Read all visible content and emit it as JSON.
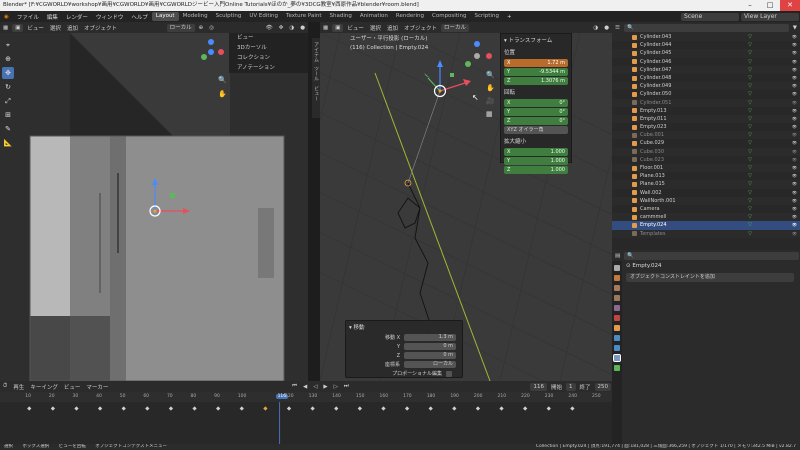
{
  "titlebar": {
    "title": "Blender* [F:¥CGWORLD¥workshop¥画用¥CGWORLD¥画用¥CGWORLDジービー入門Online Tutorials¥ほのか_夢の¥3DCG教室¥西原作品¥blender¥room.blend]"
  },
  "menubar": {
    "items": [
      "ファイル",
      "編集",
      "レンダー",
      "ウィンドウ",
      "ヘルプ"
    ],
    "workspaces": [
      "Layout",
      "Modeling",
      "Sculpting",
      "UV Editing",
      "Texture Paint",
      "Shading",
      "Animation",
      "Rendering",
      "Compositing",
      "Scripting"
    ],
    "active_workspace": "Layout",
    "scene": "Scene",
    "view_layer": "View Layer"
  },
  "viewport_left": {
    "header": [
      "ビュー",
      "選択",
      "追加",
      "オブジェクト"
    ],
    "transform": "ローカル",
    "overlay_menu": [
      "ビュー",
      "3Dカーソル",
      "コレクション",
      "アノテーション"
    ]
  },
  "viewport_right": {
    "header": [
      "ビュー",
      "選択",
      "追加",
      "オブジェクト"
    ],
    "transform": "ローカル",
    "info_line1": "ユーザー・平行投影 (ローカル)",
    "info_line2": "(116) Collection | Empty.024",
    "side_tabs": [
      "アイテム",
      "ツール",
      "ビュー"
    ]
  },
  "npanel": {
    "title": "トランスフォーム",
    "location_label": "位置",
    "location": [
      {
        "axis": "X",
        "value": "1.72 m"
      },
      {
        "axis": "Y",
        "value": "-9.5344 m"
      },
      {
        "axis": "Z",
        "value": "1.3076 m"
      }
    ],
    "rotation_label": "回転",
    "rotation": [
      {
        "axis": "X",
        "value": "0°"
      },
      {
        "axis": "Y",
        "value": "0°"
      },
      {
        "axis": "Z",
        "value": "0°"
      }
    ],
    "mode": "XYZ オイラー角",
    "scale_label": "拡大縮小",
    "scale": [
      {
        "axis": "X",
        "value": "1.000"
      },
      {
        "axis": "Y",
        "value": "1.000"
      },
      {
        "axis": "Z",
        "value": "1.000"
      }
    ]
  },
  "operator_panel": {
    "title": "移動",
    "rows": [
      {
        "label": "移動 X",
        "value": "1.3 m"
      },
      {
        "label": "Y",
        "value": "0 m"
      },
      {
        "label": "Z",
        "value": "0 m"
      },
      {
        "label": "座標系",
        "value": "ローカル"
      },
      {
        "label": "プロポーショナル編集",
        "value": ""
      }
    ]
  },
  "outliner": {
    "rows": [
      {
        "name": "Cylinder.043",
        "state": "normal"
      },
      {
        "name": "Cylinder.044",
        "state": "normal"
      },
      {
        "name": "Cylinder.045",
        "state": "normal"
      },
      {
        "name": "Cylinder.046",
        "state": "normal"
      },
      {
        "name": "Cylinder.047",
        "state": "normal"
      },
      {
        "name": "Cylinder.048",
        "state": "normal"
      },
      {
        "name": "Cylinder.049",
        "state": "normal"
      },
      {
        "name": "Cylinder.050",
        "state": "normal"
      },
      {
        "name": "Cylinder.051",
        "state": "dim"
      },
      {
        "name": "Empty.013",
        "state": "normal"
      },
      {
        "name": "Empty.011",
        "state": "normal"
      },
      {
        "name": "Empty.023",
        "state": "normal"
      },
      {
        "name": "Cube.001",
        "state": "dim"
      },
      {
        "name": "Cube.029",
        "state": "normal"
      },
      {
        "name": "Cube.030",
        "state": "dim"
      },
      {
        "name": "Cube.023",
        "state": "dim"
      },
      {
        "name": "Floor.001",
        "state": "normal"
      },
      {
        "name": "Plane.013",
        "state": "normal"
      },
      {
        "name": "Plane.015",
        "state": "normal"
      },
      {
        "name": "Wall.002",
        "state": "normal"
      },
      {
        "name": "WallNorth.001",
        "state": "normal"
      },
      {
        "name": "Camera",
        "state": "normal"
      },
      {
        "name": "cammmell",
        "state": "normal"
      },
      {
        "name": "Empty.024",
        "state": "selected"
      },
      {
        "name": "Templates",
        "state": "dim"
      }
    ]
  },
  "properties": {
    "object_name": "Empty.024",
    "add_constraint": "オブジェクトコンストレイントを追加"
  },
  "timeline": {
    "header": [
      "再生",
      "キーイング",
      "ビュー",
      "マーカー"
    ],
    "current_frame": "116",
    "start_label": "開始",
    "start": "1",
    "end_label": "終了",
    "end": "250",
    "ticks": [
      "10",
      "20",
      "30",
      "40",
      "50",
      "60",
      "70",
      "80",
      "90",
      "100",
      "116",
      "120",
      "130",
      "140",
      "150",
      "160",
      "170",
      "180",
      "190",
      "200",
      "210",
      "220",
      "230",
      "240",
      "250"
    ]
  },
  "statusbar": {
    "left": [
      "選択",
      "ボックス選択",
      "ビューを回転",
      "オブジェクトコンテクストメニュー"
    ],
    "right": "Collection | Empty.024 | 頂点:191,774 | 面:181,028 | 三角面:366,259 | オブジェクト 1/170 | メモリ:342.5 MiB | v2.82.7"
  }
}
